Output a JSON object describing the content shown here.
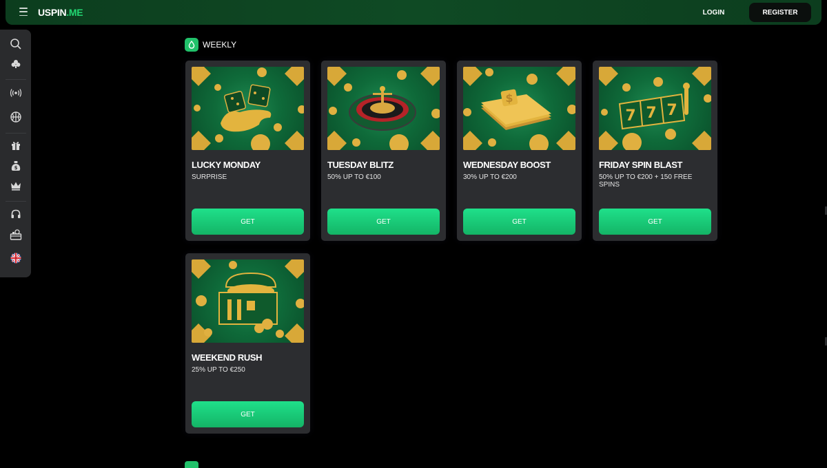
{
  "header": {
    "logo_part1": "USPIN",
    "logo_part2": ".ME",
    "login_label": "LOGIN",
    "register_label": "REGISTER"
  },
  "sidebar": {
    "items": [
      {
        "icon": "search-icon"
      },
      {
        "icon": "club-icon"
      },
      {
        "icon": "live-broadcast-icon"
      },
      {
        "icon": "basketball-icon"
      },
      {
        "icon": "gift-icon"
      },
      {
        "icon": "money-bag-icon"
      },
      {
        "icon": "crown-icon"
      },
      {
        "icon": "headset-icon"
      },
      {
        "icon": "cashier-icon"
      },
      {
        "icon": "uk-flag-icon"
      }
    ]
  },
  "section": {
    "title": "WEEKLY",
    "icon": "drop-icon"
  },
  "cards": [
    {
      "title": "LUCKY MONDAY",
      "subtitle": "SURPRISE",
      "button": "GET",
      "art": "dice-hand"
    },
    {
      "title": "TUESDAY BLITZ",
      "subtitle": "50% UP TO €100",
      "button": "GET",
      "art": "roulette"
    },
    {
      "title": "WEDNESDAY BOOST",
      "subtitle": "30% UP TO €200",
      "button": "GET",
      "art": "money-stack"
    },
    {
      "title": "FRIDAY SPIN BLAST",
      "subtitle": "50% UP TO €200 + 150 FREE SPINS",
      "button": "GET",
      "art": "slot-777"
    },
    {
      "title": "WEEKEND RUSH",
      "subtitle": "25% UP TO €250",
      "button": "GET",
      "art": "treasure-chest"
    }
  ],
  "colors": {
    "accent": "#22d672",
    "button": "#19c774",
    "card_bg": "#2c2d30",
    "sidebar_bg": "#2a2b2d",
    "header_bg": "#0f4a24"
  }
}
